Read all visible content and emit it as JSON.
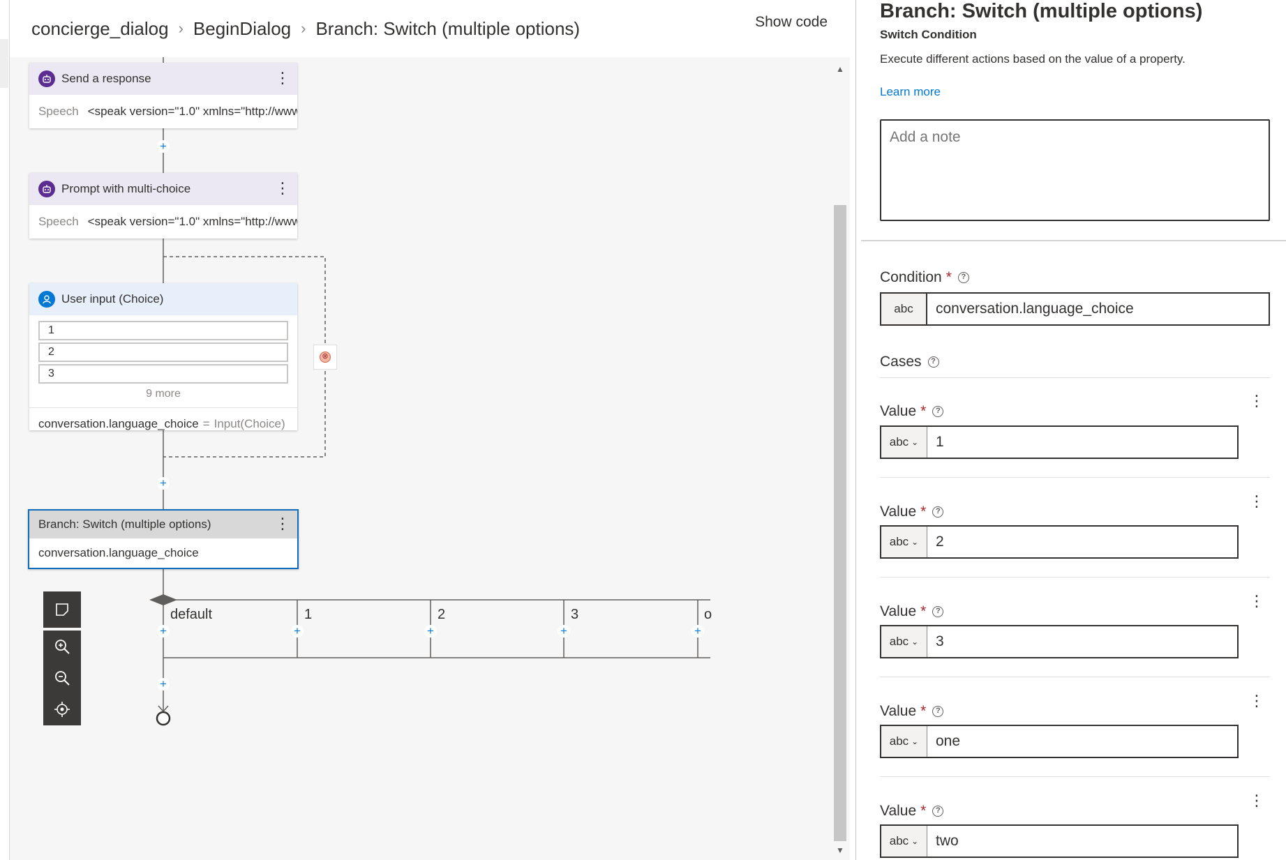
{
  "breadcrumb": [
    "concierge_dialog",
    "BeginDialog",
    "Branch: Switch (multiple options)"
  ],
  "header": {
    "show_code": "Show code"
  },
  "canvas": {
    "send_response": {
      "title": "Send a response",
      "key": "Speech",
      "value": "<speak version=\"1.0\" xmlns=\"http://www...."
    },
    "prompt": {
      "title": "Prompt with multi-choice",
      "key": "Speech",
      "value": "<speak version=\"1.0\" xmlns=\"http://www...."
    },
    "user_input": {
      "title": "User input (Choice)",
      "choices": [
        "1",
        "2",
        "3"
      ],
      "more": "9 more",
      "property": "conversation.language_choice",
      "eq": "=",
      "fn": "Input(Choice)"
    },
    "switch": {
      "title": "Branch: Switch (multiple options)",
      "condition": "conversation.language_choice"
    },
    "branches": [
      "default",
      "1",
      "2",
      "3",
      "o"
    ],
    "icons": {
      "response": "bot-icon",
      "prompt": "bot-icon",
      "input": "user-icon",
      "error": "error-icon",
      "minimap": "minimap-icon",
      "zoom_in": "zoom-in-icon",
      "zoom_out": "zoom-out-icon",
      "locate": "locate-icon"
    },
    "colors": {
      "accent": "#0078d4",
      "bot": "#5c2d91",
      "selected_border": "#0f6cbd"
    }
  },
  "panel": {
    "title": "Branch: Switch (multiple options)",
    "subtitle": "Switch Condition",
    "description": "Execute different actions based on the value of a property.",
    "learn_more": "Learn more",
    "note_placeholder": "Add a note",
    "condition_label": "Condition",
    "required": "*",
    "condition_type": "abc",
    "condition_value": "conversation.language_choice",
    "cases_label": "Cases",
    "value_label": "Value",
    "case_type": "abc",
    "cases": [
      "1",
      "2",
      "3",
      "one",
      "two"
    ]
  }
}
